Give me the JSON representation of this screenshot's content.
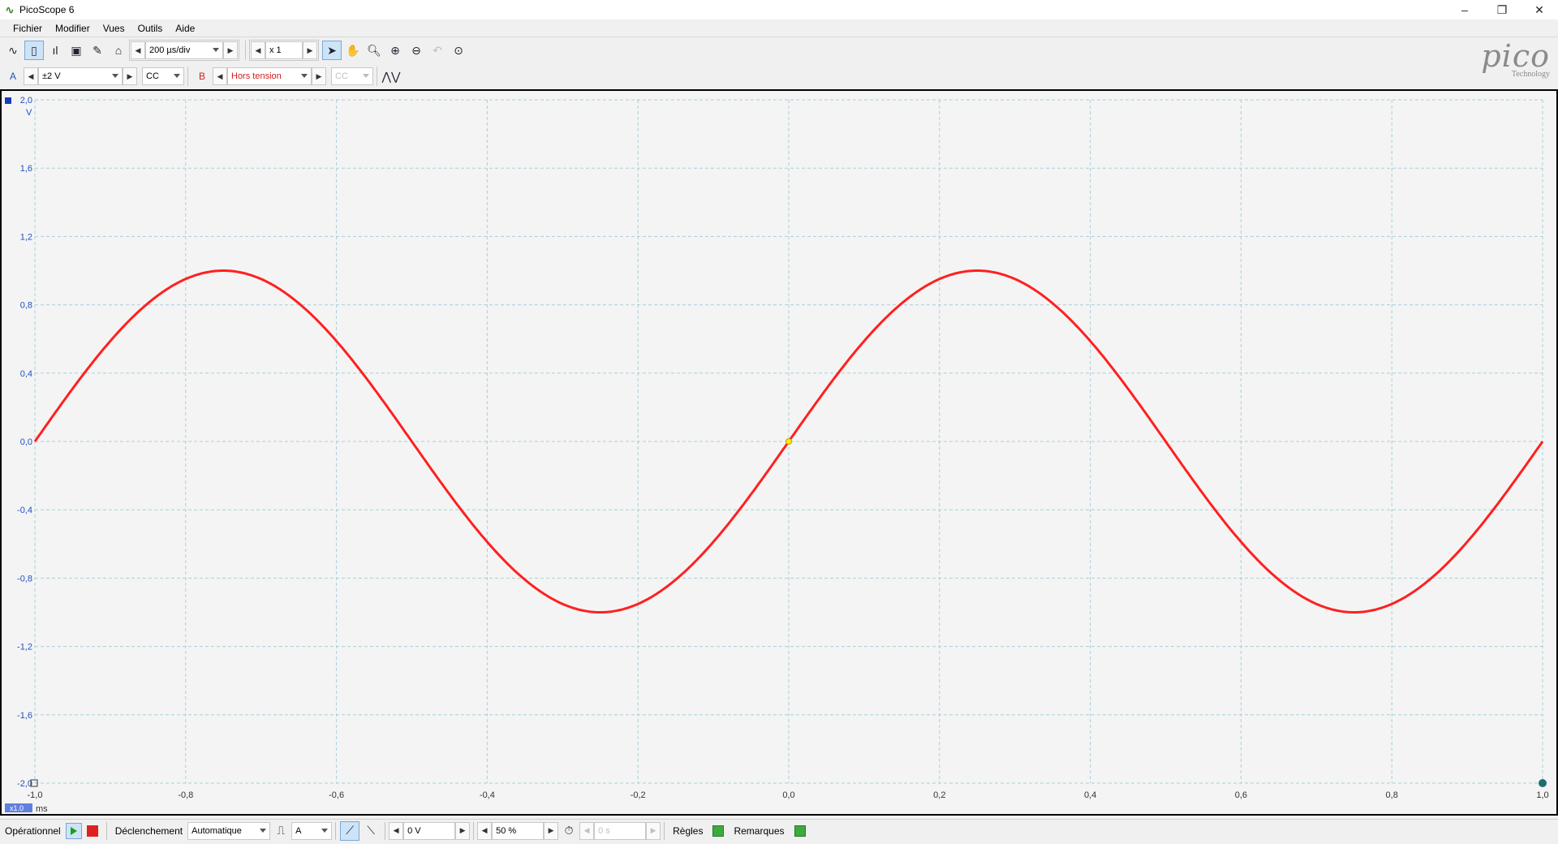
{
  "window": {
    "title": "PicoScope 6",
    "controls": [
      "–",
      "❐",
      "✕"
    ]
  },
  "menu": [
    "Fichier",
    "Modifier",
    "Vues",
    "Outils",
    "Aide"
  ],
  "toolbar1": {
    "timebase": "200 µs/div",
    "zoom": "x 1"
  },
  "toolbar2": {
    "channelA": {
      "label": "A",
      "range": "±2 V",
      "coupling": "CC"
    },
    "channelB": {
      "label": "B",
      "range": "Hors tension",
      "coupling": "CC"
    }
  },
  "logo": {
    "word": "pico",
    "sub": "Technology"
  },
  "scope": {
    "yunit": "V",
    "xunit": "ms",
    "xscale_badge": "x1.0",
    "yticks": [
      "2,0",
      "1,6",
      "1,2",
      "0,8",
      "0,4",
      "0,0",
      "-0,4",
      "-0,8",
      "-1,2",
      "-1,6",
      "-2,0"
    ],
    "xticks": [
      "-1,0",
      "-0,8",
      "-0,6",
      "-0,4",
      "-0,2",
      "0,0",
      "0,2",
      "0,4",
      "0,6",
      "0,8",
      "1,0"
    ]
  },
  "chart_data": {
    "type": "line",
    "xlabel": "ms",
    "ylabel": "V",
    "xlim": [
      -1.0,
      1.0
    ],
    "ylim": [
      -2.0,
      2.0
    ],
    "grid": true,
    "series": [
      {
        "color": "#ff2020",
        "amplitude": 1.0,
        "period_ms": 1.0,
        "phase_ms": 0.0,
        "waveform": "sine"
      }
    ],
    "trigger_point": {
      "x": 0.0,
      "y": 0.0
    }
  },
  "statusbar": {
    "mode": "Opérationnel",
    "trigger_label": "Déclenchement",
    "trigger_mode": "Automatique",
    "trigger_source": "A",
    "threshold": "0 V",
    "pretrigger": "50 %",
    "delay": "0 s",
    "rulers": "Règles",
    "notes": "Remarques"
  }
}
